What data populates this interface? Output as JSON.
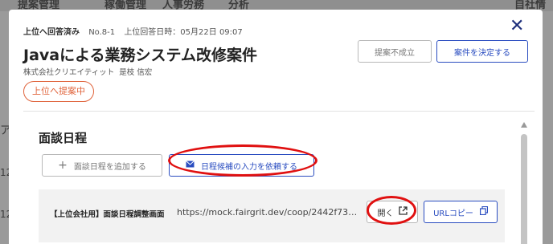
{
  "background": {
    "nav_tabs": [
      "提案管理",
      "稼働管理",
      "人事労務",
      "分析",
      "自社情"
    ],
    "fragments": [
      "ア",
      "12",
      "12"
    ]
  },
  "header": {
    "status": "上位へ回答済み",
    "number": "No.8-1",
    "answered_at": "上位回答日時：05月22日 09:07",
    "title": "Javaによる業務システム改修案件",
    "company": "株式会社クリエイティット",
    "person": "是枝 信宏",
    "status_pill": "上位へ提案中"
  },
  "actions": {
    "reject_label": "提案不成立",
    "decide_label": "案件を決定する"
  },
  "interview": {
    "section_title": "面談日程",
    "add_label": "面談日程を追加する",
    "request_label": "日程候補の入力を依頼する",
    "row": {
      "label": "【上位会社用】面談日程調整画面",
      "url": "https://mock.fairgrit.dev/coop/2442f736...",
      "open_label": "開く",
      "copy_label": "URLコピー"
    }
  },
  "colors": {
    "accent": "#2a4dc0",
    "status_orange": "#e0643c",
    "annotation_red": "#e01010"
  }
}
